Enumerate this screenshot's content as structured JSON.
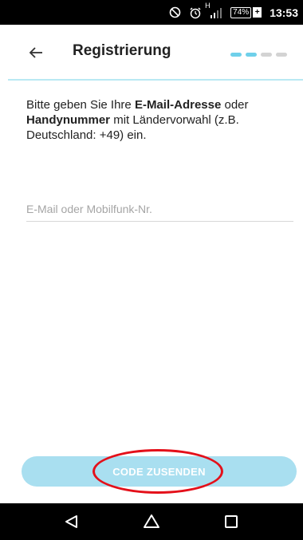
{
  "status_bar": {
    "network_type": "H",
    "battery_level": "74%",
    "time": "13:53",
    "icons": [
      "do-not-disturb-icon",
      "alarm-icon",
      "signal-icon",
      "battery-icon",
      "charging-icon"
    ]
  },
  "header": {
    "title": "Registrierung",
    "back_icon": "arrow-left-icon",
    "progress": {
      "total_steps": 4,
      "active_steps": 2
    }
  },
  "instruction": {
    "part1": "Bitte geben Sie Ihre ",
    "bold1": "E-Mail-Adresse",
    "part2": " oder ",
    "bold2": "Handynummer",
    "part3": " mit Ländervorwahl (z.B. Deutschland: +49) ein."
  },
  "form": {
    "contact_placeholder": "E-Mail oder Mobilfunk-Nr.",
    "contact_value": ""
  },
  "actions": {
    "send_code_label": "CODE ZUSENDEN"
  },
  "nav_bar": {
    "icons": [
      "back-triangle-icon",
      "home-icon",
      "recents-icon"
    ]
  },
  "colors": {
    "accent": "#6fd0ea",
    "button": "#a9dff0",
    "annotation": "#e4101a"
  }
}
